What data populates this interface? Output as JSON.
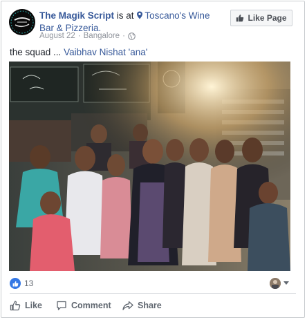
{
  "post": {
    "author": "The Magik Script",
    "is_at": "is at",
    "location": "Toscano's Wine Bar & Pizzeria.",
    "date": "August 22",
    "separator": "·",
    "city": "Bangalore",
    "separator2": "·",
    "caption_text": "the squad ... ",
    "caption_tags": "Vaibhav Nishat 'ana'"
  },
  "avatar_logo_text": "The Magik Script",
  "header": {
    "like_page_label": "Like Page"
  },
  "reactions": {
    "count": "13"
  },
  "actions": {
    "like": "Like",
    "comment": "Comment",
    "share": "Share"
  },
  "icons": {
    "pin": "map-pin-icon",
    "globe": "globe-icon",
    "thumb": "thumbs-up-icon",
    "comment": "speech-bubble-icon",
    "share": "share-arrow-icon",
    "chevron": "chevron-down-icon"
  },
  "colors": {
    "link": "#365899",
    "meta": "#90949c",
    "like_blue": "#3578e5",
    "action_text": "#606770"
  }
}
